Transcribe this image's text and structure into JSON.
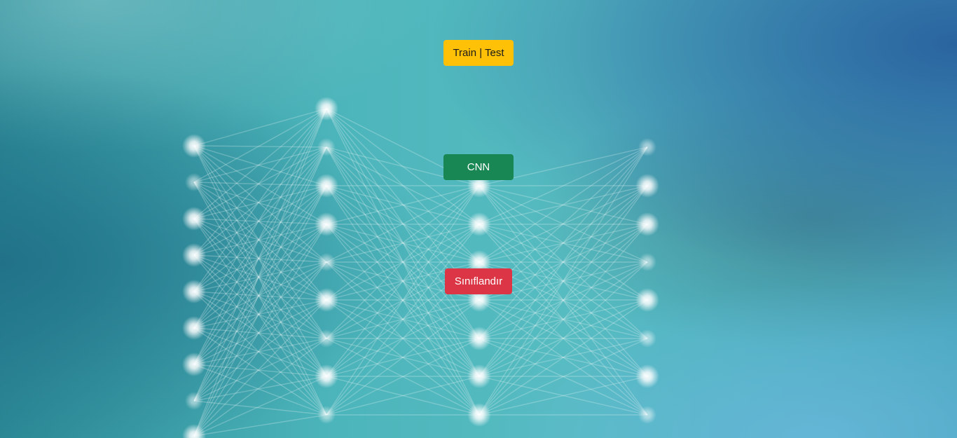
{
  "colors": {
    "train_test_bg": "#ffc107",
    "cnn_bg": "#198754",
    "classify_bg": "#dc3545",
    "background_teal": "#4fb8be",
    "background_dark": "#2a7e8e",
    "background_blue": "#2f6fa0"
  },
  "buttons": {
    "train_test": "Train | Test",
    "cnn": "CNN",
    "classify": "Sınıflandır"
  },
  "background": {
    "icon": "neural-network-illustration"
  }
}
